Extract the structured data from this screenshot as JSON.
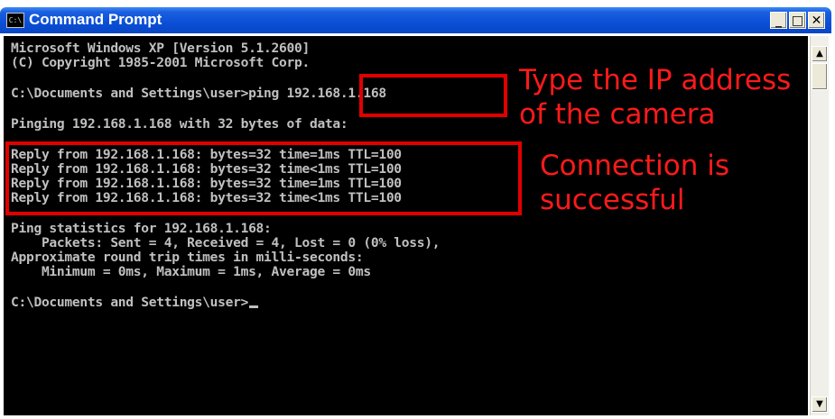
{
  "window": {
    "title": "Command Prompt",
    "icon_label": "C:\\",
    "minimize_label": "_",
    "maximize_label": "□",
    "close_label": "✕"
  },
  "console": {
    "lines": [
      "Microsoft Windows XP [Version 5.1.2600]",
      "(C) Copyright 1985-2001 Microsoft Corp.",
      "",
      "C:\\Documents and Settings\\user>ping 192.168.1.168",
      "",
      "Pinging 192.168.1.168 with 32 bytes of data:",
      "",
      "Reply from 192.168.1.168: bytes=32 time=1ms TTL=100",
      "Reply from 192.168.1.168: bytes=32 time<1ms TTL=100",
      "Reply from 192.168.1.168: bytes=32 time=1ms TTL=100",
      "Reply from 192.168.1.168: bytes=32 time<1ms TTL=100",
      "",
      "Ping statistics for 192.168.1.168:",
      "    Packets: Sent = 4, Received = 4, Lost = 0 (0% loss),",
      "Approximate round trip times in milli-seconds:",
      "    Minimum = 0ms, Maximum = 1ms, Average = 0ms",
      "",
      "C:\\Documents and Settings\\user>"
    ]
  },
  "annotations": {
    "ip_line1": "Type the IP address",
    "ip_line2": "of the camera",
    "conn_line1": "Connection is",
    "conn_line2": "successful",
    "color": "#e00000"
  },
  "scrollbar": {
    "up_arrow": "▲",
    "down_arrow": "▼"
  }
}
